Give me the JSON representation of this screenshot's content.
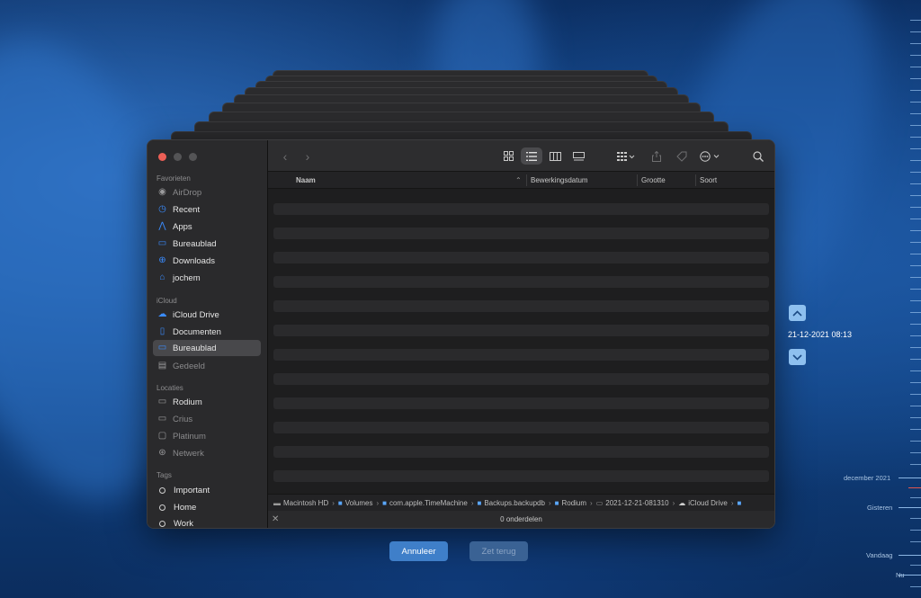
{
  "sidebar": {
    "sections": [
      {
        "title": "Favorieten"
      },
      {
        "title": "iCloud"
      },
      {
        "title": "Locaties"
      },
      {
        "title": "Tags"
      }
    ],
    "favorites": [
      "AirDrop",
      "Recent",
      "Apps",
      "Bureaublad",
      "Downloads",
      "jochem"
    ],
    "icloud": [
      "iCloud Drive",
      "Documenten",
      "Bureaublad",
      "Gedeeld"
    ],
    "locations": [
      "Rodium",
      "Crius",
      "Platinum",
      "Netwerk"
    ],
    "tags": [
      "Important",
      "Home",
      "Work"
    ]
  },
  "columns": {
    "name": "Naam",
    "modified": "Bewerkingsdatum",
    "size": "Grootte",
    "kind": "Soort"
  },
  "pathbar": {
    "segments": [
      "Macintosh HD",
      "Volumes",
      "com.apple.TimeMachine",
      "Backups.backupdb",
      "Rodium",
      "2021-12-21-081310",
      "iCloud Drive"
    ]
  },
  "status": {
    "items_count": "0 onderdelen"
  },
  "buttons": {
    "cancel": "Annuleer",
    "restore": "Zet terug"
  },
  "timemachine": {
    "current_date": "21-12-2021 08:13",
    "timeline_labels": [
      "december 2021",
      "Gisteren",
      "Vandaag",
      "Nu"
    ]
  },
  "colors": {
    "accent": "#3a8cff",
    "selected_sidebar": "#48484b",
    "cancel_button": "#3f7fc9"
  }
}
